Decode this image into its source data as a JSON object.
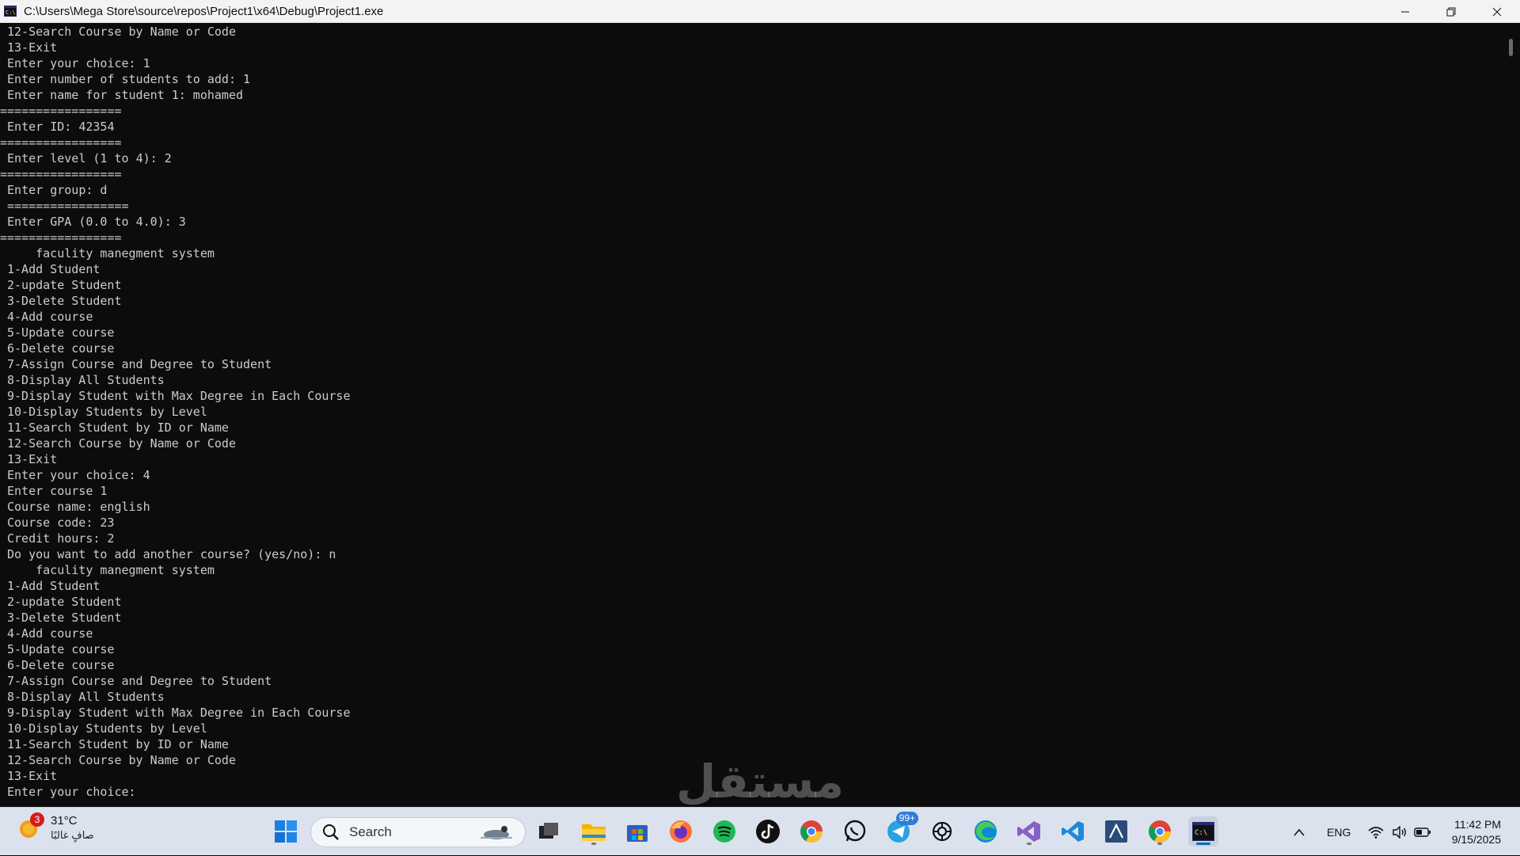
{
  "window": {
    "title": "C:\\Users\\Mega Store\\source\\repos\\Project1\\x64\\Debug\\Project1.exe"
  },
  "console": {
    "lines": [
      "12-Search Course by Name or Code",
      "13-Exit",
      "Enter your choice: 1",
      "Enter number of students to add: 1",
      "Enter name for student 1: mohamed",
      "=================",
      " Enter ID: 42354",
      "=================",
      " Enter level (1 to 4): 2",
      "=================",
      " Enter group: d",
      " =================",
      " Enter GPA (0.0 to 4.0): 3",
      "=================",
      "    faculity manegment system",
      "1-Add Student",
      "2-update Student",
      "3-Delete Student",
      "4-Add course",
      "5-Update course",
      "6-Delete course",
      "7-Assign Course and Degree to Student",
      "8-Display All Students",
      "9-Display Student with Max Degree in Each Course",
      "10-Display Students by Level",
      "11-Search Student by ID or Name",
      "12-Search Course by Name or Code",
      "13-Exit",
      "Enter your choice: 4",
      "Enter course 1",
      "Course name: english",
      "Course code: 23",
      "Credit hours: 2",
      "Do you want to add another course? (yes/no): n",
      "    faculity manegment system",
      "1-Add Student",
      "2-update Student",
      "3-Delete Student",
      "4-Add course",
      "5-Update course",
      "6-Delete course",
      "7-Assign Course and Degree to Student",
      "8-Display All Students",
      "9-Display Student with Max Degree in Each Course",
      "10-Display Students by Level",
      "11-Search Student by ID or Name",
      "12-Search Course by Name or Code",
      "13-Exit",
      "Enter your choice:"
    ]
  },
  "watermark": {
    "text": "مستقل"
  },
  "taskbar": {
    "weather": {
      "badge": "3",
      "temp": "31°C",
      "condition": "صافٍ غالبًا"
    },
    "search_label": "Search",
    "telegram_badge": "99+",
    "language": "ENG",
    "time": "11:42 PM",
    "date": "9/15/2025"
  },
  "colors": {
    "console_bg": "#0c0c0c",
    "console_text": "#cccccc",
    "taskbar_bg": "#dbe2ee",
    "accent": "#0067c0"
  }
}
